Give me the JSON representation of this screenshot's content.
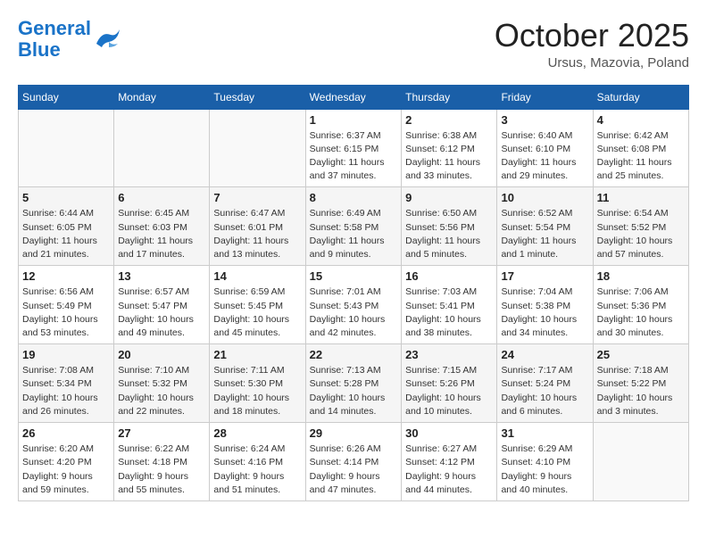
{
  "header": {
    "logo_line1": "General",
    "logo_line2": "Blue",
    "month": "October 2025",
    "location": "Ursus, Mazovia, Poland"
  },
  "weekdays": [
    "Sunday",
    "Monday",
    "Tuesday",
    "Wednesday",
    "Thursday",
    "Friday",
    "Saturday"
  ],
  "weeks": [
    [
      {
        "day": "",
        "info": ""
      },
      {
        "day": "",
        "info": ""
      },
      {
        "day": "",
        "info": ""
      },
      {
        "day": "1",
        "info": "Sunrise: 6:37 AM\nSunset: 6:15 PM\nDaylight: 11 hours and 37 minutes."
      },
      {
        "day": "2",
        "info": "Sunrise: 6:38 AM\nSunset: 6:12 PM\nDaylight: 11 hours and 33 minutes."
      },
      {
        "day": "3",
        "info": "Sunrise: 6:40 AM\nSunset: 6:10 PM\nDaylight: 11 hours and 29 minutes."
      },
      {
        "day": "4",
        "info": "Sunrise: 6:42 AM\nSunset: 6:08 PM\nDaylight: 11 hours and 25 minutes."
      }
    ],
    [
      {
        "day": "5",
        "info": "Sunrise: 6:44 AM\nSunset: 6:05 PM\nDaylight: 11 hours and 21 minutes."
      },
      {
        "day": "6",
        "info": "Sunrise: 6:45 AM\nSunset: 6:03 PM\nDaylight: 11 hours and 17 minutes."
      },
      {
        "day": "7",
        "info": "Sunrise: 6:47 AM\nSunset: 6:01 PM\nDaylight: 11 hours and 13 minutes."
      },
      {
        "day": "8",
        "info": "Sunrise: 6:49 AM\nSunset: 5:58 PM\nDaylight: 11 hours and 9 minutes."
      },
      {
        "day": "9",
        "info": "Sunrise: 6:50 AM\nSunset: 5:56 PM\nDaylight: 11 hours and 5 minutes."
      },
      {
        "day": "10",
        "info": "Sunrise: 6:52 AM\nSunset: 5:54 PM\nDaylight: 11 hours and 1 minute."
      },
      {
        "day": "11",
        "info": "Sunrise: 6:54 AM\nSunset: 5:52 PM\nDaylight: 10 hours and 57 minutes."
      }
    ],
    [
      {
        "day": "12",
        "info": "Sunrise: 6:56 AM\nSunset: 5:49 PM\nDaylight: 10 hours and 53 minutes."
      },
      {
        "day": "13",
        "info": "Sunrise: 6:57 AM\nSunset: 5:47 PM\nDaylight: 10 hours and 49 minutes."
      },
      {
        "day": "14",
        "info": "Sunrise: 6:59 AM\nSunset: 5:45 PM\nDaylight: 10 hours and 45 minutes."
      },
      {
        "day": "15",
        "info": "Sunrise: 7:01 AM\nSunset: 5:43 PM\nDaylight: 10 hours and 42 minutes."
      },
      {
        "day": "16",
        "info": "Sunrise: 7:03 AM\nSunset: 5:41 PM\nDaylight: 10 hours and 38 minutes."
      },
      {
        "day": "17",
        "info": "Sunrise: 7:04 AM\nSunset: 5:38 PM\nDaylight: 10 hours and 34 minutes."
      },
      {
        "day": "18",
        "info": "Sunrise: 7:06 AM\nSunset: 5:36 PM\nDaylight: 10 hours and 30 minutes."
      }
    ],
    [
      {
        "day": "19",
        "info": "Sunrise: 7:08 AM\nSunset: 5:34 PM\nDaylight: 10 hours and 26 minutes."
      },
      {
        "day": "20",
        "info": "Sunrise: 7:10 AM\nSunset: 5:32 PM\nDaylight: 10 hours and 22 minutes."
      },
      {
        "day": "21",
        "info": "Sunrise: 7:11 AM\nSunset: 5:30 PM\nDaylight: 10 hours and 18 minutes."
      },
      {
        "day": "22",
        "info": "Sunrise: 7:13 AM\nSunset: 5:28 PM\nDaylight: 10 hours and 14 minutes."
      },
      {
        "day": "23",
        "info": "Sunrise: 7:15 AM\nSunset: 5:26 PM\nDaylight: 10 hours and 10 minutes."
      },
      {
        "day": "24",
        "info": "Sunrise: 7:17 AM\nSunset: 5:24 PM\nDaylight: 10 hours and 6 minutes."
      },
      {
        "day": "25",
        "info": "Sunrise: 7:18 AM\nSunset: 5:22 PM\nDaylight: 10 hours and 3 minutes."
      }
    ],
    [
      {
        "day": "26",
        "info": "Sunrise: 6:20 AM\nSunset: 4:20 PM\nDaylight: 9 hours and 59 minutes."
      },
      {
        "day": "27",
        "info": "Sunrise: 6:22 AM\nSunset: 4:18 PM\nDaylight: 9 hours and 55 minutes."
      },
      {
        "day": "28",
        "info": "Sunrise: 6:24 AM\nSunset: 4:16 PM\nDaylight: 9 hours and 51 minutes."
      },
      {
        "day": "29",
        "info": "Sunrise: 6:26 AM\nSunset: 4:14 PM\nDaylight: 9 hours and 47 minutes."
      },
      {
        "day": "30",
        "info": "Sunrise: 6:27 AM\nSunset: 4:12 PM\nDaylight: 9 hours and 44 minutes."
      },
      {
        "day": "31",
        "info": "Sunrise: 6:29 AM\nSunset: 4:10 PM\nDaylight: 9 hours and 40 minutes."
      },
      {
        "day": "",
        "info": ""
      }
    ]
  ]
}
